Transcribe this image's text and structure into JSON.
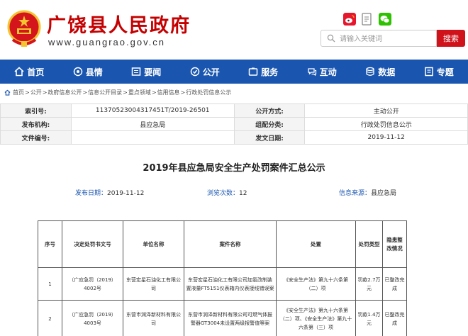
{
  "header": {
    "site_title": "广饶县人民政府",
    "site_url": "www.guangrao.gov.cn",
    "search_placeholder": "请输入关键词",
    "search_button": "搜索",
    "colors": {
      "brand_red": "#c40000",
      "nav_blue": "#1a56b0",
      "search_red": "#d0121b"
    }
  },
  "nav": [
    {
      "label": "首页",
      "icon": "home-icon"
    },
    {
      "label": "县情",
      "icon": "county-icon"
    },
    {
      "label": "要闻",
      "icon": "news-icon"
    },
    {
      "label": "公开",
      "icon": "open-icon"
    },
    {
      "label": "服务",
      "icon": "service-icon"
    },
    {
      "label": "互动",
      "icon": "interact-icon"
    },
    {
      "label": "数据",
      "icon": "data-icon"
    },
    {
      "label": "专题",
      "icon": "topic-icon"
    }
  ],
  "breadcrumb": [
    "首页",
    "公开",
    "政府信息公开",
    "信息公开目录",
    "重点领域",
    "信用信息",
    "行政处罚信息公示"
  ],
  "info": {
    "index_label": "索引号:",
    "index_value": "11370523004317451T/2019-26501",
    "mode_label": "公开方式:",
    "mode_value": "主动公开",
    "issuer_label": "发布机构:",
    "issuer_value": "县应急局",
    "category_label": "组配分类:",
    "category_value": "行政处罚信息公示",
    "docno_label": "文件编号:",
    "docno_value": "",
    "date_label": "发文日期:",
    "date_value": "2019-11-12"
  },
  "article": {
    "title": "2019年县应急局安全生产处罚案件汇总公示",
    "publish_label": "发布日期：",
    "publish_value": "2019-11-12",
    "views_label": "浏览次数：",
    "views_value": "12",
    "source_label": "信息来源：",
    "source_value": "县应急局"
  },
  "cases": {
    "headers": [
      "序号",
      "决定处罚书文号",
      "单位名称",
      "案件名称",
      "处置",
      "处罚类型",
      "隐患整改情况"
    ],
    "rows": [
      {
        "no": "1",
        "doc": "（广应急罚（2019）4002号",
        "unit": "东营宏星石油化工有限公司",
        "case": "东营宏星石油化工有限公司加氢改制装置液量FT5151仪表箱内仪表接线错误案",
        "action": "《安全生产法》第九十六条第（二）项",
        "type": "罚款2.7万元",
        "fix": "已整改完成"
      },
      {
        "no": "2",
        "doc": "（广应急罚（2019）4003号",
        "unit": "东营市润泽新材料有限公司",
        "case": "东营市润泽新材料有限公司可燃气体报警器GT3004未设置两级报警值等案",
        "action": "《安全生产法》第九十六条第（二）项、《安全生产法》第九十六条第（三）项",
        "type": "罚款1.4万元",
        "fix": "已整改完成"
      }
    ]
  }
}
